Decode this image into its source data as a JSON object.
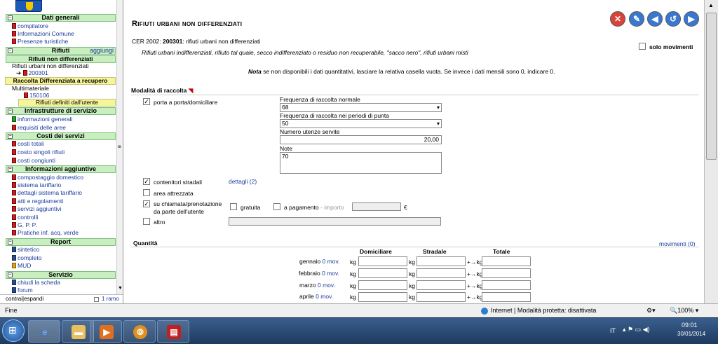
{
  "sidebar": {
    "dati_generali": "Dati generali",
    "compilatore": "compilatore",
    "informazioni_comune": "Informazioni Comune",
    "presenze_turistiche": "Presenze turistiche",
    "rifiuti": "Rifiuti",
    "aggiungi": "aggiungi",
    "rifiuti_non_diff": "Rifiuti non differenziati",
    "rifiuti_urbani_non_diff": "Rifiuti urbani non differenziati",
    "code_200301": "200301",
    "raccolta_diff": "Raccolta Differenziata a recupero",
    "multimateriale": "Multimateriale",
    "code_150106": "150106",
    "rifiuti_definiti": "Rifiuti definiti dall'utente",
    "infrastrutture": "Infrastrutture di servizio",
    "informazioni_generali": "informazioni generali",
    "requisiti_aree": "requisiti delle aree",
    "costi_servizi": "Costi dei servizi",
    "costi_totali": "costi totali",
    "costo_singoli": "costo singoli rifiuti",
    "costi_congiunti": "costi congiunti",
    "info_aggiuntive": "Informazioni aggiuntive",
    "compostaggio": "compostaggio domestico",
    "sistema_tariffario": "sistema tariffario",
    "dettagli_tariffario": "dettagli sistema tariffario",
    "atti_regolamenti": "atti e regolamenti",
    "servizi_aggiuntivi": "servizi aggiuntivi",
    "controlli": "controlli",
    "gpp": "G. P. P.",
    "pratiche": "Pratiche inf. acq. verde",
    "report": "Report",
    "sintetico": "sintetico",
    "completo": "completo",
    "mud": "MUD",
    "servizio": "Servizio",
    "chiudi_scheda": "chiudi la scheda",
    "forum": "forum",
    "contrai_espandi": "contrai|espandi",
    "un_ramo": "1 ramo"
  },
  "main": {
    "title": "Rifiuti urbani non differenziati",
    "cer_label": "CER 2002:",
    "cer_code": "200301",
    "cer_desc": ": rifiuti urbani non differenziati",
    "description": "Rifiuti urbani indifferenziati, rifiuto tal quale, secco indifferenziato o residuo non recuperabile, \"sacco nero\", rifiuti urbani misti",
    "solo_movimenti": "solo movimenti",
    "nota_bold": "Nota",
    "nota_text": " se non disponibili i dati quantitativi, lasciare la relativa casella vuota. Se invece i dati mensili sono 0, indicare 0.",
    "modalita_title": "Modalità di raccolta",
    "porta_a_porta": "porta a porta/domiciliare",
    "freq_normale_label": "Frequenza di raccolta normale",
    "freq_normale_value": "68",
    "freq_punta_label": "Frequenza di raccolta nei periodi di punta",
    "freq_punta_value": "50",
    "utenze_label": "Numero utenze servite",
    "utenze_value": "20,00",
    "note_label": "Note",
    "note_value": "70",
    "contenitori_stradali": "contenitori stradali",
    "dettagli": "dettagli (2)",
    "area_attrezzata": "area attrezzata",
    "su_chiamata_1": "su chiamata/prenotazione",
    "su_chiamata_2": "da parte dell'utente",
    "gratuita": "gratuita",
    "a_pagamento": "a pagamento",
    "importo": "- importo",
    "euro": "€",
    "altro": "altro",
    "quantita_title": "Quantità",
    "movimenti": "movimenti (0)",
    "col_domiciliare": "Domiciliare",
    "col_stradale": "Stradale",
    "col_totale": "Totale",
    "kg": "kg",
    "arrow": "+→",
    "months": [
      {
        "name": "gennaio",
        "mov": "0 mov."
      },
      {
        "name": "febbraio",
        "mov": "0 mov."
      },
      {
        "name": "marzo",
        "mov": "0 mov."
      },
      {
        "name": "aprile",
        "mov": "0 mov."
      }
    ]
  },
  "statusbar": {
    "left": "Fine",
    "zone": "Internet | Modalità protetta: disattivata",
    "zoom": "100%"
  },
  "taskbar": {
    "lang": "IT",
    "time": "09:01",
    "date": "30/01/2014"
  },
  "colors": {
    "section_green": "#c9efc1",
    "highlight_yellow": "#f7f59a",
    "link_blue": "#1a3c9c",
    "close_red": "#d9443a",
    "nav_blue": "#3a78d0"
  }
}
